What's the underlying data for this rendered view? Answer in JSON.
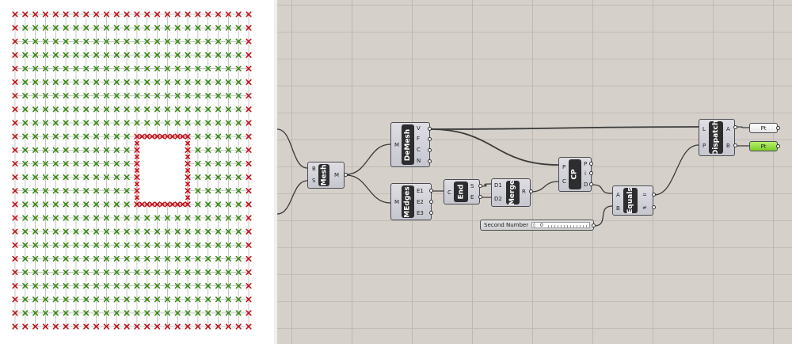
{
  "colors": {
    "canvas_bg": "#d5d1ca",
    "grid_line": "#bdb9b2",
    "wire": "#3a3a3a",
    "component_body": "#d2d3d9",
    "component_name_bg": "#2d2d30",
    "panel_white": "#ffffff",
    "panel_green": "#8bd63a",
    "point_red": "#c0141a",
    "point_green": "#3a8a16",
    "viewport_line": "#b0b0b0",
    "edge_line": "#d24048"
  },
  "viewport": {
    "grid_columns": 24,
    "grid_rows": 24,
    "hole_columns": [
      12,
      17
    ],
    "hole_rows": [
      9,
      14
    ]
  },
  "components": {
    "mesh": {
      "name": "Mesh",
      "inputs": [
        "B",
        "S"
      ],
      "outputs": [
        "M"
      ]
    },
    "demesh": {
      "name": "DeMesh",
      "inputs": [
        "M"
      ],
      "outputs": [
        "V",
        "F",
        "C",
        "N"
      ]
    },
    "medges": {
      "name": "MEdges",
      "inputs": [
        "M"
      ],
      "outputs": [
        "E1",
        "E2",
        "E3"
      ]
    },
    "end": {
      "name": "End",
      "inputs": [
        "C"
      ],
      "outputs": [
        "S",
        "E"
      ]
    },
    "merge": {
      "name": "Merge",
      "inputs": [
        "D1",
        "D2"
      ],
      "outputs": [
        "R"
      ]
    },
    "cp": {
      "name": "CP",
      "inputs": [
        "P",
        "C"
      ],
      "outputs": [
        "P",
        "i",
        "D"
      ]
    },
    "equals": {
      "name": "Equals",
      "inputs": [
        "A",
        "B"
      ],
      "outputs": [
        "=",
        "≠"
      ]
    },
    "dispatch": {
      "name": "Dispatch",
      "inputs": [
        "L",
        "P"
      ],
      "outputs": [
        "A",
        "B"
      ]
    }
  },
  "panels": {
    "panel_a": {
      "label": "Pt"
    },
    "panel_b": {
      "label": "Pt"
    }
  },
  "slider": {
    "label": "Second Number",
    "knob": "◊",
    "value": "0"
  }
}
